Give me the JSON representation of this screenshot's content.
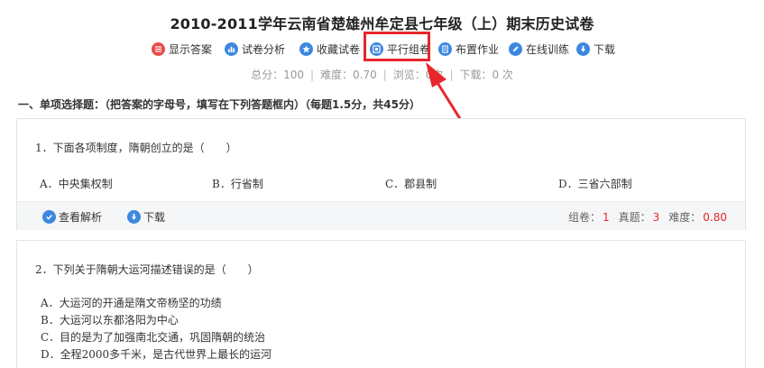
{
  "title": "2010-2011学年云南省楚雄州牟定县七年级（上）期末历史试卷",
  "toolbar": {
    "items": [
      {
        "label": "显示答案",
        "icon": "list-icon",
        "color": "#e94b46"
      },
      {
        "label": "试卷分析",
        "icon": "bar-chart-icon",
        "color": "#3d87e0"
      },
      {
        "label": "收藏试卷",
        "icon": "star-icon",
        "color": "#3d87e0"
      },
      {
        "label": "平行组卷",
        "icon": "group-icon",
        "color": "#3d87e0"
      },
      {
        "label": "布置作业",
        "icon": "assignment-icon",
        "color": "#3d87e0"
      },
      {
        "label": "在线训练",
        "icon": "pencil-icon",
        "color": "#3d87e0"
      },
      {
        "label": "下载",
        "icon": "download-icon",
        "color": "#3d87e0"
      }
    ]
  },
  "stats": {
    "total": "总分：100",
    "difficulty": "难度：0.70",
    "views": "浏览：0次",
    "downloads": "下载：0 次"
  },
  "section": {
    "title": "一、单项选择题：（把答案的字母号，填写在下列答题框内）（每题1.5分，共45分）"
  },
  "questions": [
    {
      "stem": "1．下面各项制度，隋朝创立的是（　　）",
      "options": [
        "A．中央集权制",
        "B．行省制",
        "C．郡县制",
        "D．三省六部制"
      ],
      "actions": {
        "analysis": "查看解析",
        "download": "下载"
      },
      "meta": {
        "group_label": "组卷：",
        "group_value": "1",
        "real_label": "真题：",
        "real_value": "3",
        "difficulty_label": "难度：",
        "difficulty_value": "0.80"
      }
    },
    {
      "stem": "2．下列关于隋朝大运河描述错误的是（　　）",
      "options": [
        "A．大运河的开通是隋文帝杨坚的功绩",
        "B．大运河以东都洛阳为中心",
        "C．目的是为了加强南北交通，巩固隋朝的统治",
        "D．全程2000多千米，是古代世界上最长的运河"
      ]
    }
  ],
  "colors": {
    "accent": "#3d87e0",
    "highlight": "#e8262c",
    "red_icon": "#e94b46"
  }
}
